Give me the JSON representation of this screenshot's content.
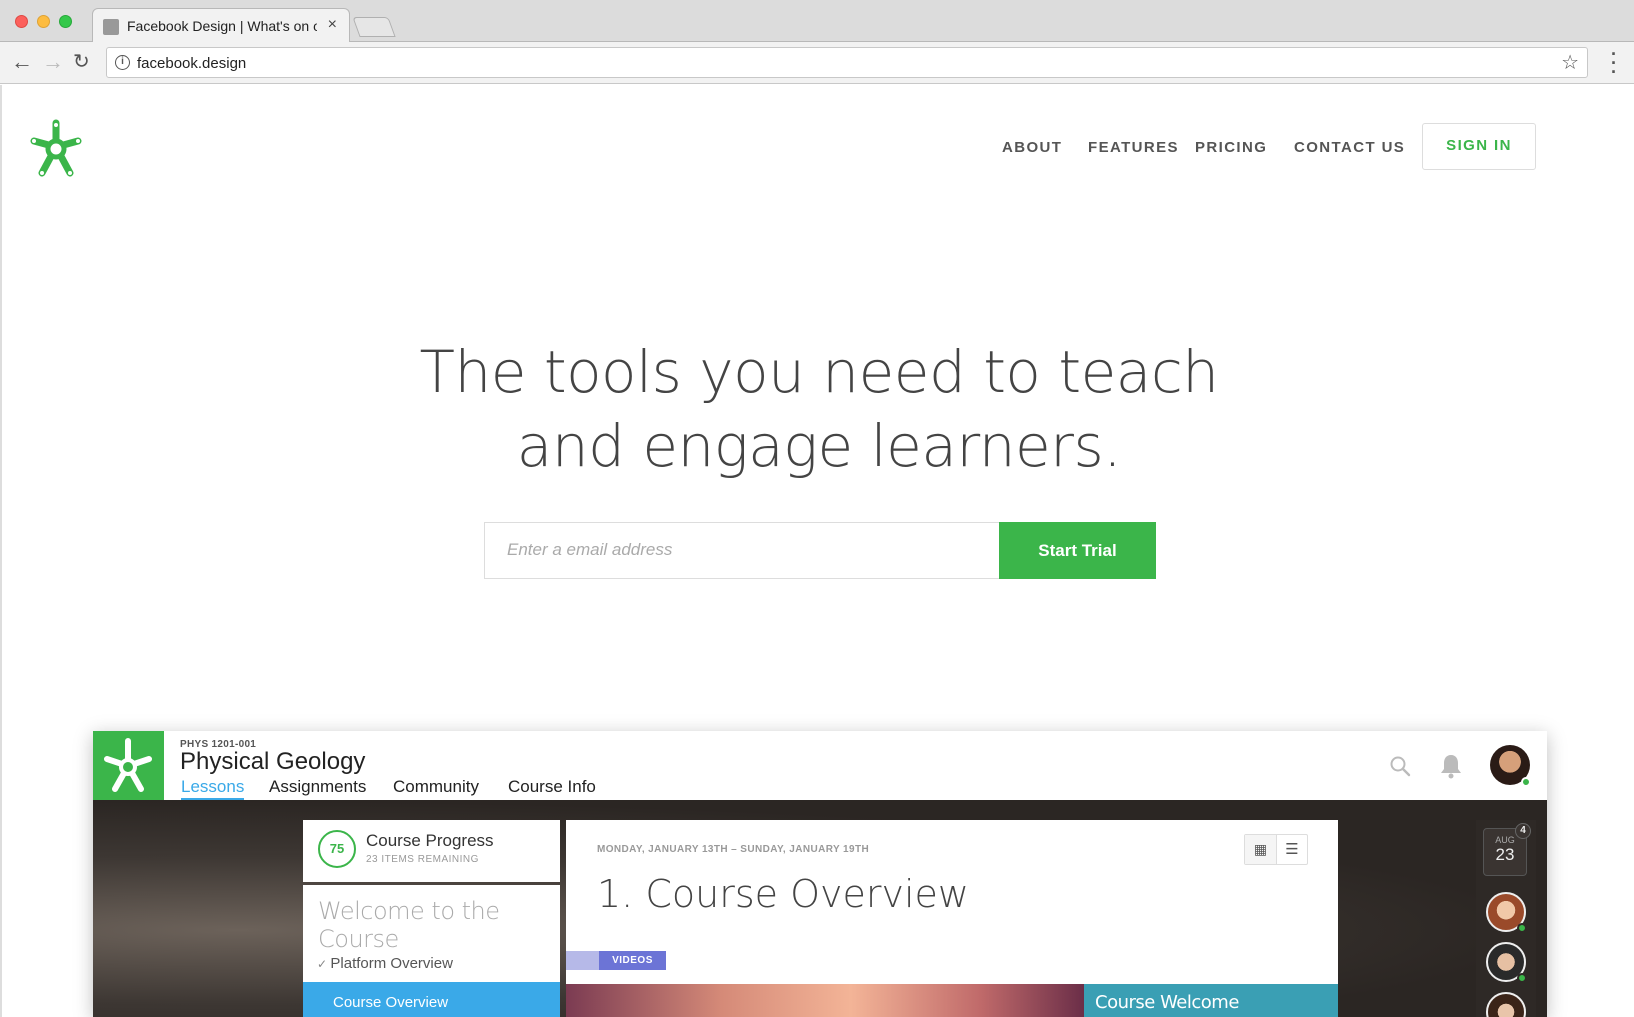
{
  "browser": {
    "tab_title": "Facebook Design | What's on o",
    "url": "facebook.design"
  },
  "site": {
    "nav": {
      "about": "ABOUT",
      "features": "FEATURES",
      "pricing": "PRICING",
      "contact": "CONTACT US",
      "signin": "SIGN IN"
    },
    "hero_line1": "The tools you need to teach",
    "hero_line2": "and engage learners.",
    "email_placeholder": "Enter a email address",
    "cta": "Start Trial"
  },
  "app": {
    "course_code": "PHYS 1201-001",
    "course_title": "Physical Geology",
    "tabs": {
      "lessons": "Lessons",
      "assignments": "Assignments",
      "community": "Community",
      "course_info": "Course Info"
    },
    "progress": {
      "percent": "75",
      "title": "Course Progress",
      "remaining": "23 ITEMS REMAINING"
    },
    "outline": {
      "heading": "Welcome to the Course",
      "completed_item": "Platform Overview",
      "active_item": "Course Overview"
    },
    "content": {
      "week_range": "MONDAY, JANUARY 13TH – SUNDAY, JANUARY 19TH",
      "lesson_title": "1. Course Overview",
      "badge": "VIDEOS",
      "welcome_card": "Course Welcome"
    },
    "calendar": {
      "month": "AUG",
      "day": "23",
      "badge_count": "4"
    }
  },
  "colors": {
    "brand_green": "#3bb54a",
    "accent_blue": "#3aa9e8",
    "badge_purple": "#6c74d6",
    "teal": "#3a9fb4"
  }
}
